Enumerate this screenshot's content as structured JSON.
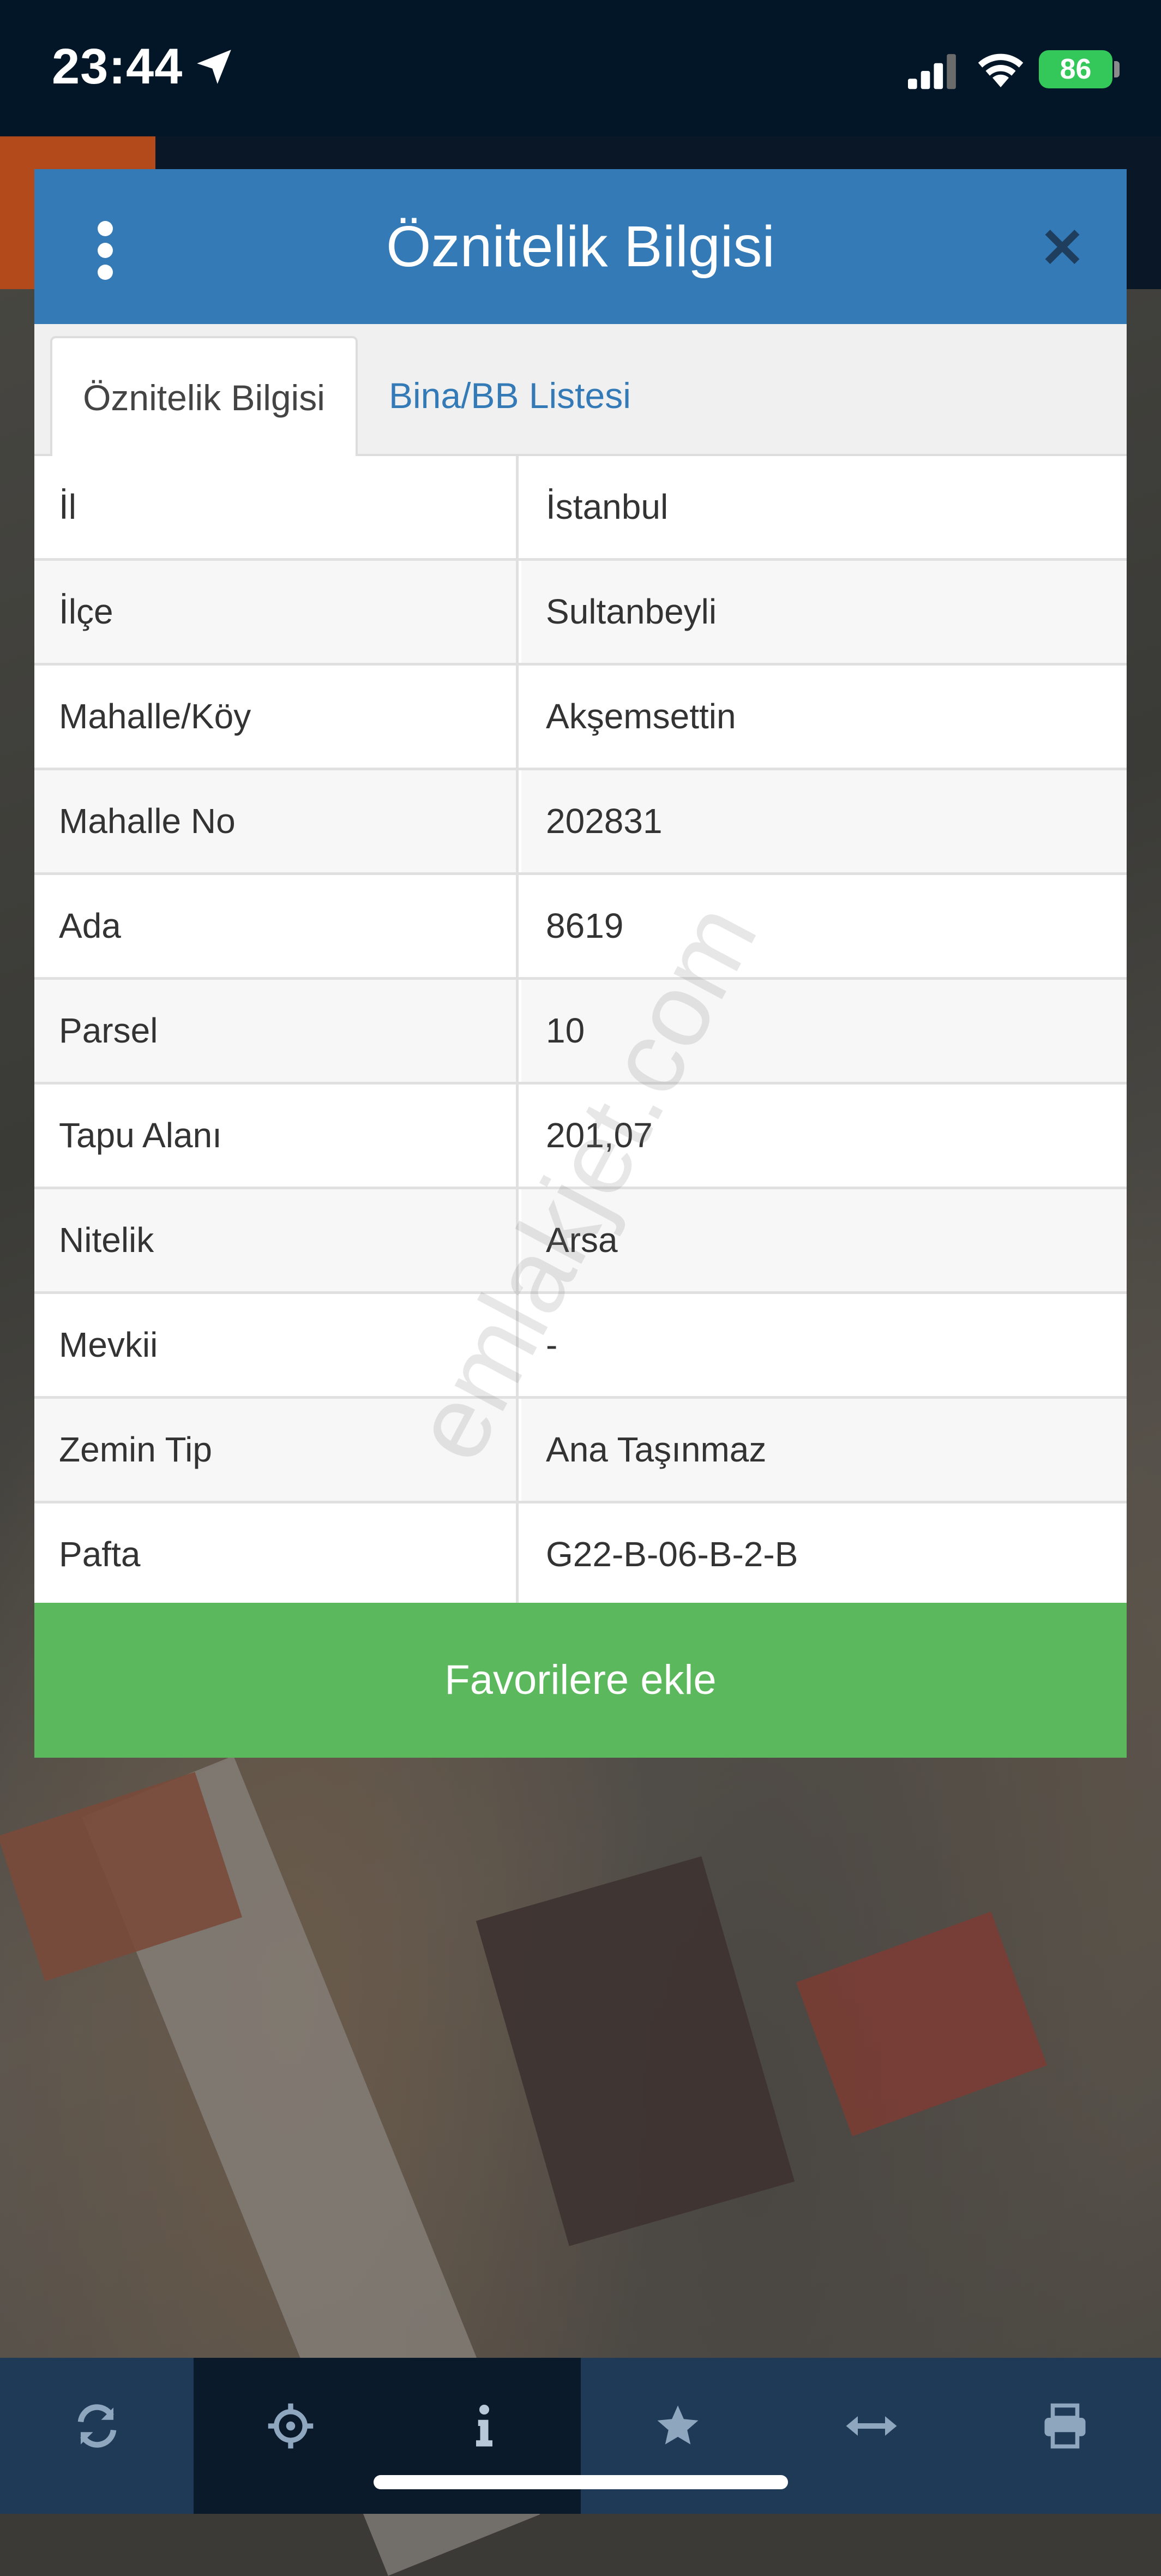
{
  "status_bar": {
    "time": "23:44",
    "battery": "86"
  },
  "modal": {
    "title": "Öznitelik Bilgisi",
    "tabs": [
      {
        "label": "Öznitelik Bilgisi",
        "active": true
      },
      {
        "label": "Bina/BB Listesi",
        "active": false
      }
    ],
    "rows": [
      {
        "key": "İl",
        "value": "İstanbul"
      },
      {
        "key": "İlçe",
        "value": "Sultanbeyli"
      },
      {
        "key": "Mahalle/Köy",
        "value": "Akşemsettin"
      },
      {
        "key": "Mahalle No",
        "value": "202831"
      },
      {
        "key": "Ada",
        "value": "8619"
      },
      {
        "key": "Parsel",
        "value": "10"
      },
      {
        "key": "Tapu Alanı",
        "value": "201,07"
      },
      {
        "key": "Nitelik",
        "value": "Arsa"
      },
      {
        "key": "Mevkii",
        "value": "-"
      },
      {
        "key": "Zemin Tip",
        "value": "Ana Taşınmaz"
      },
      {
        "key": "Pafta",
        "value": "G22-B-06-B-2-B"
      }
    ],
    "favorite_button": "Favorilere ekle",
    "watermark": "emlakjet.com"
  },
  "toolbar": {
    "icons": [
      "refresh-icon",
      "crosshair-icon",
      "info-icon",
      "star-icon",
      "measure-icon",
      "print-icon"
    ],
    "active_index": 2
  },
  "colors": {
    "header": "#337ab7",
    "favorite": "#5cb85c",
    "status_bar": "#021627",
    "toolbar": "#1f3a57"
  }
}
